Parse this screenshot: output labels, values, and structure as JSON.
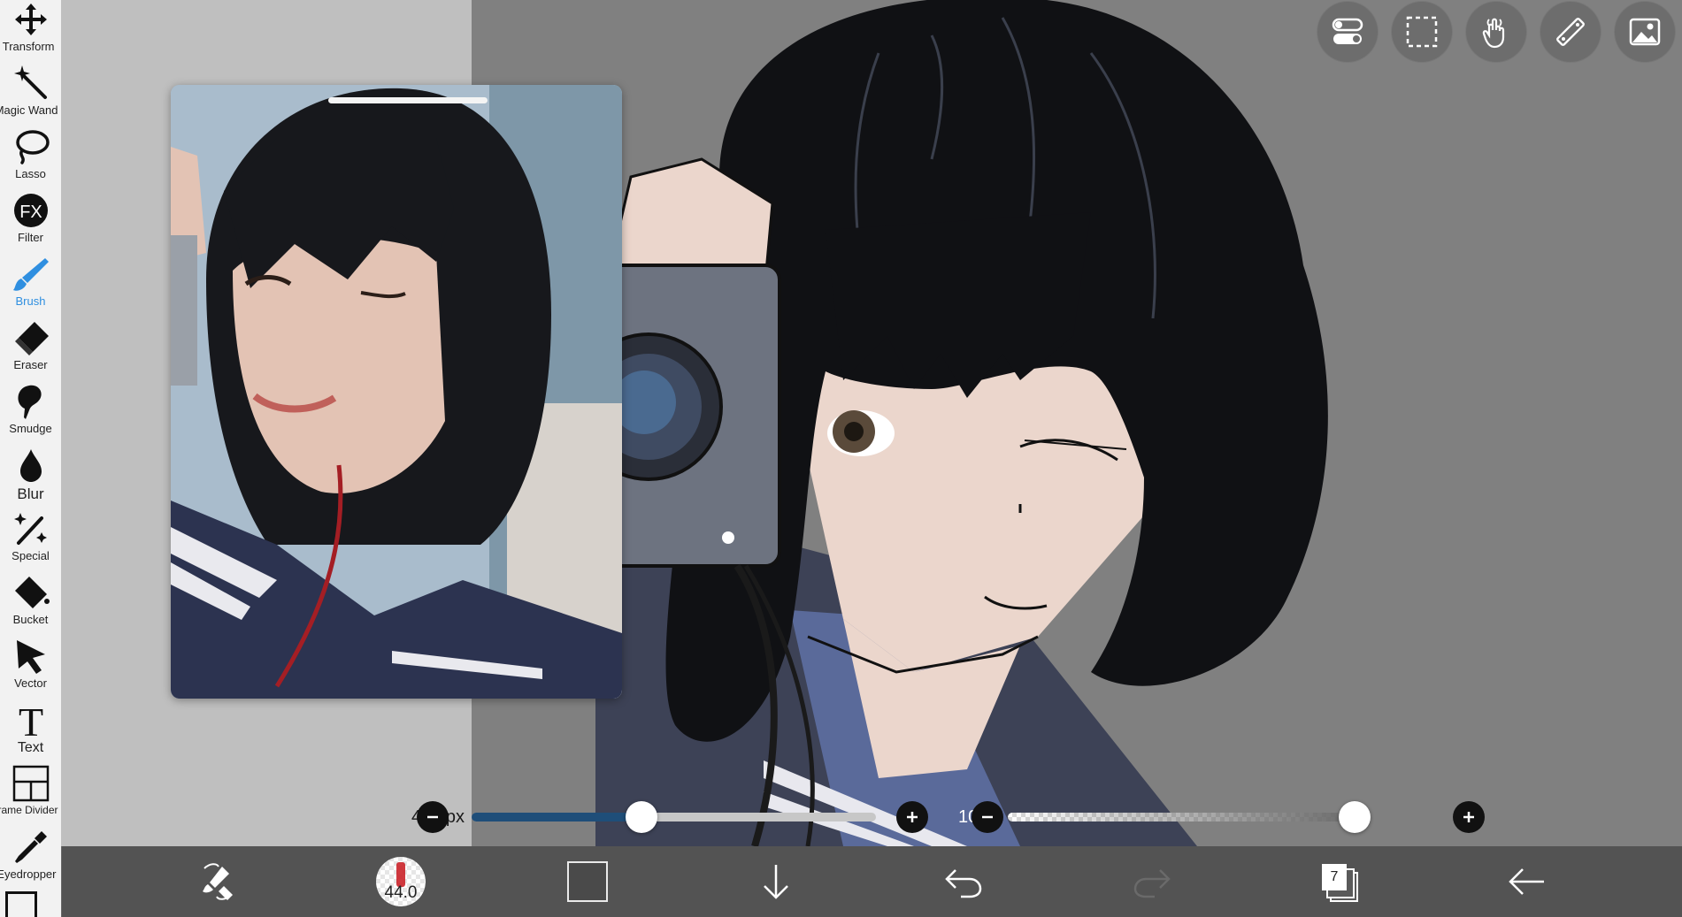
{
  "sidebar": {
    "tools": [
      {
        "label": "Transform",
        "icon": "move-arrows-icon",
        "active": false
      },
      {
        "label": "Magic Wand",
        "icon": "magic-wand-icon",
        "active": false
      },
      {
        "label": "Lasso",
        "icon": "lasso-icon",
        "active": false
      },
      {
        "label": "Filter",
        "icon": "fx-icon",
        "active": false
      },
      {
        "label": "Brush",
        "icon": "brush-icon",
        "active": true
      },
      {
        "label": "Eraser",
        "icon": "eraser-icon",
        "active": false
      },
      {
        "label": "Smudge",
        "icon": "smudge-icon",
        "active": false
      },
      {
        "label": "Blur",
        "icon": "drop-icon",
        "active": false
      },
      {
        "label": "Special",
        "icon": "sparkle-pen-icon",
        "active": false
      },
      {
        "label": "Bucket",
        "icon": "bucket-icon",
        "active": false
      },
      {
        "label": "Vector",
        "icon": "pointer-icon",
        "active": false
      },
      {
        "label": "Text",
        "icon": "text-icon",
        "active": false
      },
      {
        "label": "Frame Divider",
        "icon": "frame-divider-icon",
        "active": false
      },
      {
        "label": "Eyedropper",
        "icon": "eyedropper-icon",
        "active": false
      }
    ]
  },
  "top_toolbar": {
    "buttons": [
      "toggle-settings-icon",
      "selection-icon",
      "hand-gesture-icon",
      "ruler-icon",
      "reference-image-icon"
    ]
  },
  "sliders": {
    "brush_size": {
      "label": "44.0px",
      "fraction": 0.42
    },
    "opacity": {
      "label": "100%",
      "fraction": 1.0
    }
  },
  "bottom_bar": {
    "brush_size_value": "44.0",
    "layer_count": "7",
    "current_color": "#4a4a4a"
  },
  "colors": {
    "accent": "#2f8fe0",
    "slider_fill": "#1f4e79"
  }
}
